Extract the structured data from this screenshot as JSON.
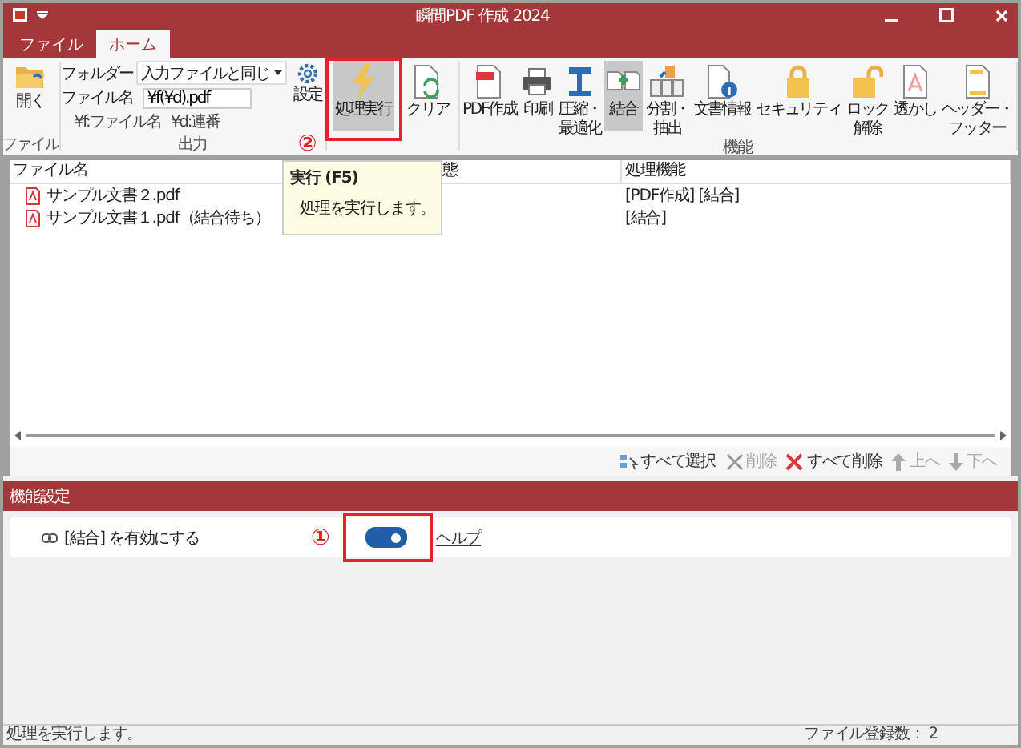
{
  "window": {
    "title": "瞬間PDF 作成 2024"
  },
  "tabs": [
    {
      "label": "ファイル",
      "selected": false
    },
    {
      "label": "ホーム",
      "selected": true
    }
  ],
  "ribbon": {
    "open": {
      "label": "開く",
      "group": "ファイル"
    },
    "output": {
      "folder_label": "フォルダー",
      "folder_value": "入力ファイルと同じ",
      "filename_label": "ファイル名",
      "filename_value": "¥f(¥d).pdf",
      "hints": [
        "¥f:ファイル名",
        "¥d:連番"
      ],
      "settings": "設定",
      "group": "出力"
    },
    "run_buttons": [
      {
        "kind": "bolt",
        "lines": [
          "処理実行"
        ],
        "selected": true,
        "annotation": "②"
      },
      {
        "kind": "clear",
        "lines": [
          "クリア"
        ],
        "selected": false
      }
    ],
    "function_buttons": [
      {
        "kind": "pdf",
        "lines": [
          "PDF作成"
        ],
        "selected": false
      },
      {
        "kind": "printer",
        "lines": [
          "印刷"
        ],
        "selected": false
      },
      {
        "kind": "compress",
        "lines": [
          "圧縮・",
          "最適化"
        ],
        "selected": false
      },
      {
        "kind": "merge",
        "lines": [
          "結合"
        ],
        "selected": true
      },
      {
        "kind": "split",
        "lines": [
          "分割・",
          "抽出"
        ],
        "selected": false
      },
      {
        "kind": "info",
        "lines": [
          "文書情報"
        ],
        "selected": false
      },
      {
        "kind": "lock",
        "lines": [
          "セキュリティ"
        ],
        "selected": false
      },
      {
        "kind": "unlock",
        "lines": [
          "ロック",
          "解除"
        ],
        "selected": false
      },
      {
        "kind": "watermark",
        "lines": [
          "透かし"
        ],
        "selected": false
      },
      {
        "kind": "header",
        "lines": [
          "ヘッダー・",
          "フッター"
        ],
        "selected": false
      }
    ],
    "function_group": "機能"
  },
  "tooltip": {
    "title": "実行 (F5)",
    "text": "処理を実行します。"
  },
  "table": {
    "columns": [
      "ファイル名",
      "態",
      "処理機能"
    ],
    "rows": [
      {
        "name": "サンプル文書２.pdf",
        "function": "[PDF作成] [結合]"
      },
      {
        "name": "サンプル文書１.pdf（結合待ち）",
        "function": "[結合]"
      }
    ]
  },
  "list_actions": [
    {
      "kind": "select-all",
      "label": "すべて選択",
      "disabled": false
    },
    {
      "kind": "delete",
      "label": "削除",
      "disabled": true
    },
    {
      "kind": "delete-all",
      "label": "すべて削除",
      "disabled": false
    },
    {
      "kind": "up",
      "label": "上へ",
      "disabled": true
    },
    {
      "kind": "down",
      "label": "下へ",
      "disabled": true
    }
  ],
  "settings": {
    "title": "機能設定",
    "label": "[結合] を有効にする",
    "on": true,
    "annotation": "①",
    "help": "ヘルプ"
  },
  "status_bar": {
    "message": "処理を実行します。",
    "count": "ファイル登録数： 2"
  }
}
